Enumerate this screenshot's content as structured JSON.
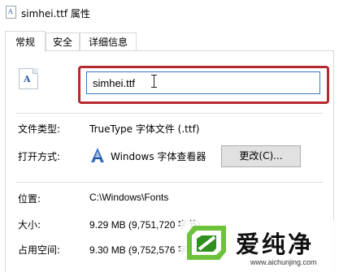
{
  "window": {
    "title": "simhei.ttf 属性"
  },
  "tabs": [
    {
      "label": "常规",
      "active": true
    },
    {
      "label": "安全",
      "active": false
    },
    {
      "label": "详细信息",
      "active": false
    }
  ],
  "general": {
    "file_name": "simhei.ttf",
    "file_type_label": "文件类型:",
    "file_type_value": "TrueType 字体文件 (.ttf)",
    "open_with_label": "打开方式:",
    "open_with_value": "Windows 字体查看器",
    "change_button": "更改(C)...",
    "location_label": "位置:",
    "location_value": "C:\\Windows\\Fonts",
    "size_label": "大小:",
    "size_value": "9.29 MB (9,751,720 字节)",
    "disk_size_label": "占用空间:",
    "disk_size_value": "9.30 MB (9,752,576 字节)"
  },
  "watermark": {
    "brand": "爱纯净",
    "url": "www.aichunjing.com"
  },
  "colors": {
    "highlight_border": "#b52a2f",
    "input_border": "#3c79c4",
    "icon_blue": "#2e5fa8",
    "logo_green": "#6cc23a"
  },
  "icons": {
    "title": "font-file-icon",
    "file": "font-file-icon",
    "app": "font-viewer-icon",
    "cursor": "text-cursor-icon",
    "logo": "aichunjing-logo"
  }
}
